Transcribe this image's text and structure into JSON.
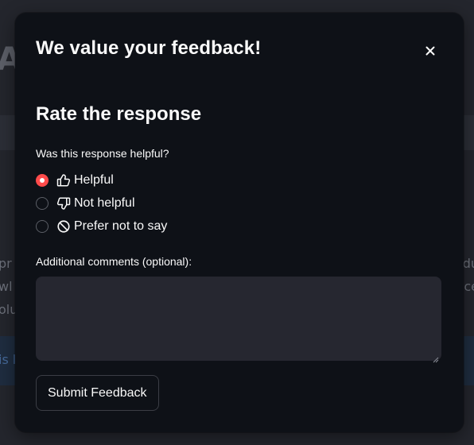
{
  "background": {
    "title_fragment": "A",
    "text_lines_left": [
      "pr",
      "wl",
      "olu"
    ],
    "text_lines_right": [
      "du",
      "ce"
    ],
    "info_fragment": "is l"
  },
  "modal": {
    "title": "We value your feedback!",
    "close_icon": "close-icon",
    "section_heading": "Rate the response",
    "question_label": "Was this response helpful?",
    "options": [
      {
        "label": "Helpful",
        "icon": "thumbs-up-icon",
        "selected": true
      },
      {
        "label": "Not helpful",
        "icon": "thumbs-down-icon",
        "selected": false
      },
      {
        "label": "Prefer not to say",
        "icon": "prohibited-icon",
        "selected": false
      }
    ],
    "comments_label": "Additional comments (optional):",
    "comments_value": "",
    "submit_label": "Submit Feedback",
    "accent_color": "#ff4b4b"
  }
}
